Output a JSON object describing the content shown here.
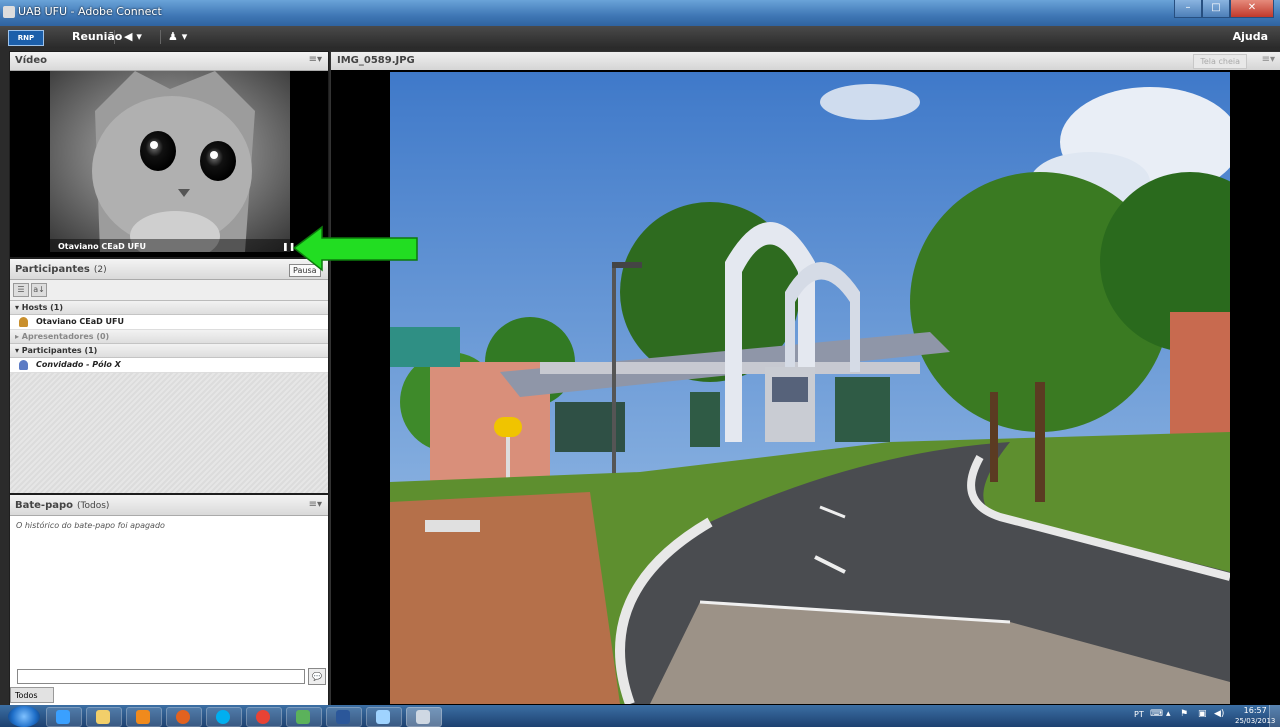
{
  "window": {
    "title": "UAB UFU - Adobe Connect"
  },
  "menubar": {
    "logo_text": "RNP",
    "meeting_menu": "Reunião",
    "help_menu": "Ajuda",
    "audio_caret": "▾",
    "cam_caret": "▾"
  },
  "video_pod": {
    "title": "Vídeo",
    "options_glyph": "≡▾",
    "presenter_name": "Otaviano CEaD UFU",
    "pause_glyph": "❚❚"
  },
  "participants_pod": {
    "title": "Participantes",
    "count": "(2)",
    "tooltip": "Pausa",
    "groups": [
      {
        "label": "▾  Hosts (1)",
        "members": [
          "Otaviano CEaD UFU"
        ]
      },
      {
        "label": "▸  Apresentadores (0)",
        "members": []
      },
      {
        "label": "▾  Participantes (1)",
        "members": [
          "Convidado - Pólo X"
        ]
      }
    ]
  },
  "chat_pod": {
    "title": "Bate-papo",
    "scope": "(Todos)",
    "options_glyph": "≡▾",
    "history_message": "O histórico do bate-papo foi apagado",
    "input_placeholder": "",
    "tab_label": "Todos"
  },
  "share_pod": {
    "title": "IMG_0589.JPG",
    "fullscreen_label": "Tela cheia",
    "options_glyph": "≡▾"
  },
  "taskbar": {
    "language": "PT",
    "time": "16:57",
    "date": "25/03/2013"
  },
  "colors": {
    "annotation_arrow": "#22dd22",
    "title_bar": "#3f77b5",
    "host_icon": "#c98f2c",
    "guest_icon": "#5c7bc4"
  }
}
